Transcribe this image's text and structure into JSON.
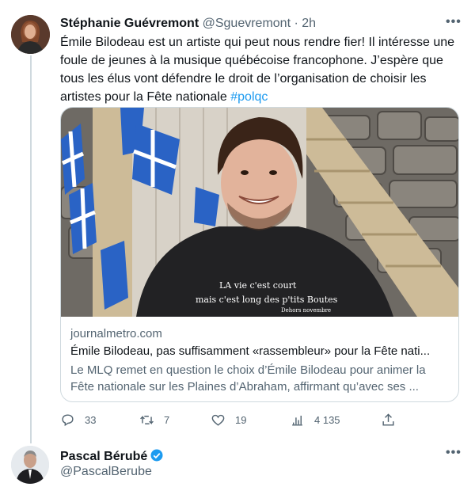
{
  "tweet": {
    "author_name": "Stéphanie Guévremont",
    "author_handle": "@Sguevremont",
    "separator": "·",
    "time": "2h",
    "text": "Émile Bilodeau est un artiste qui peut nous rendre fier! Il intéresse une foule de jeunes à la musique québécoise francophone. J’espère que tous les élus vont défendre le droit de l’organisation de choisir les artistes pour la Fête nationale",
    "hashtag": "#polqc",
    "card": {
      "domain": "journalmetro.com",
      "title": "Émile Bilodeau, pas suffisamment «rassembleur» pour la Fête nati...",
      "description": "Le MLQ remet en question le choix d’Émile Bilodeau pour animer la Fête nationale sur les Plaines d’Abraham, affirmant qu’avec ses ...",
      "image_shirt_text_1": "LA vie c'est court",
      "image_shirt_text_2": "mais c'est long des p'tits Boutes",
      "image_shirt_text_3": "Dehors novembre"
    },
    "actions": {
      "reply_count": "33",
      "retweet_count": "7",
      "like_count": "19",
      "views_count": "4 135"
    }
  },
  "next_tweet": {
    "author_name": "Pascal Bérubé",
    "author_handle": "@PascalBerube",
    "verified": true
  },
  "colors": {
    "accent": "#1d9bf0",
    "secondary_text": "#536471",
    "border": "#cfd9de"
  }
}
